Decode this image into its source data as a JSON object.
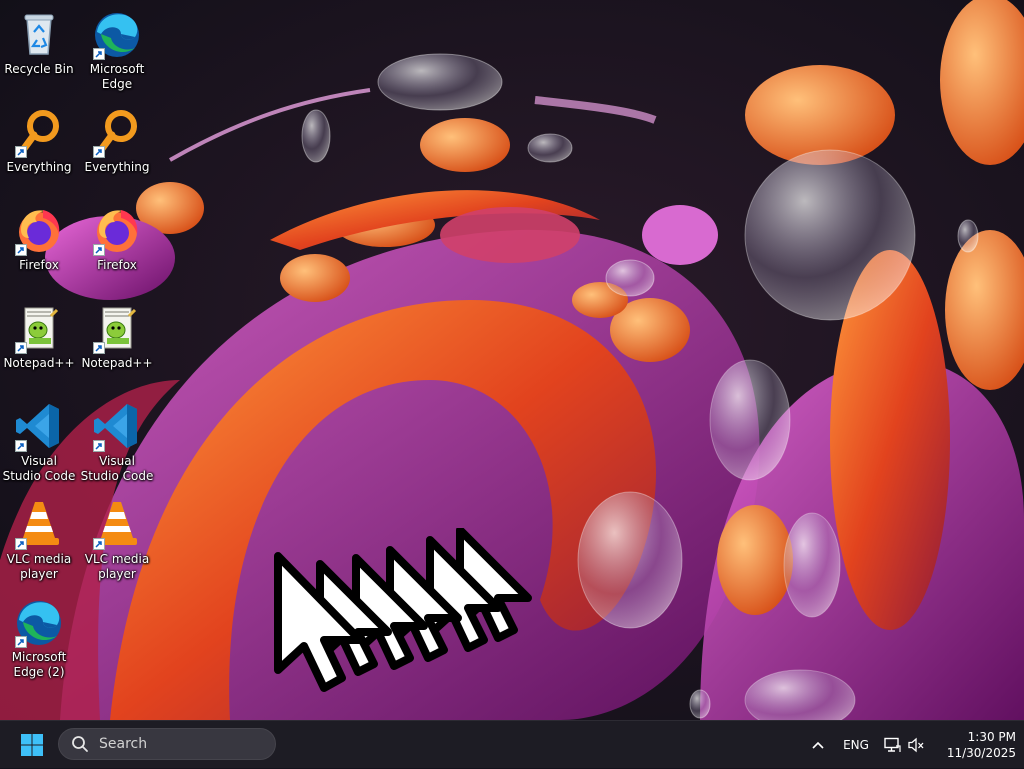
{
  "desktop": {
    "icons": [
      {
        "label": "Recycle Bin",
        "icon": "recycle-bin-icon"
      },
      {
        "label": "Microsoft Edge",
        "icon": "edge-icon"
      },
      {
        "label": "Everything",
        "icon": "everything-search-icon"
      },
      {
        "label": "Everything",
        "icon": "everything-search-icon"
      },
      {
        "label": "Firefox",
        "icon": "firefox-icon"
      },
      {
        "label": "Firefox",
        "icon": "firefox-icon"
      },
      {
        "label": "Notepad++",
        "icon": "notepad-plus-plus-icon"
      },
      {
        "label": "Notepad++",
        "icon": "notepad-plus-plus-icon"
      },
      {
        "label": "Visual Studio Code",
        "icon": "vscode-icon"
      },
      {
        "label": "Visual Studio Code",
        "icon": "vscode-icon"
      },
      {
        "label": "VLC media player",
        "icon": "vlc-icon"
      },
      {
        "label": "VLC media player",
        "icon": "vlc-icon"
      },
      {
        "label": "Microsoft Edge (2)",
        "icon": "edge-icon"
      }
    ]
  },
  "taskbar": {
    "start_icon": "windows-start-icon",
    "search": {
      "placeholder": "Search",
      "value": ""
    },
    "tray": {
      "chevron_icon": "chevron-up-icon",
      "language": "ENG",
      "network_icon": "network-icon",
      "volume_icon": "volume-muted-icon"
    },
    "clock": {
      "time": "1:30 PM",
      "date": "11/30/2025"
    }
  },
  "colors": {
    "taskbar_bg": "#1d1c24",
    "accent_blue": "#0078d4",
    "wallpaper_orange": "#e8581c",
    "wallpaper_magenta": "#b3259b"
  }
}
